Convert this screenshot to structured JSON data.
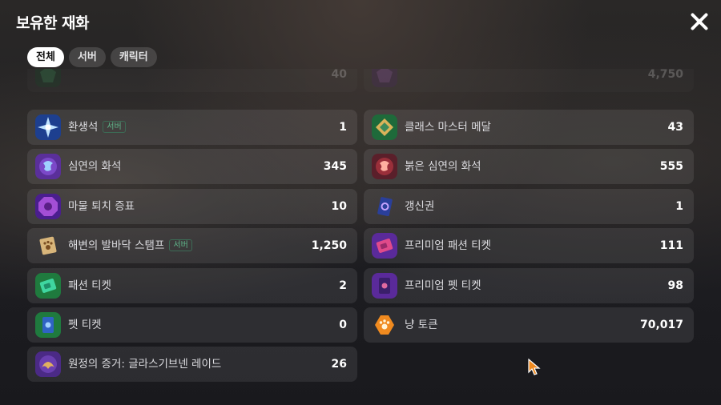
{
  "header": {
    "title": "보유한 재화"
  },
  "tabs": [
    {
      "label": "전체",
      "active": true
    },
    {
      "label": "서버",
      "active": false
    },
    {
      "label": "캐릭터",
      "active": false
    }
  ],
  "left_items": [
    {
      "name": "",
      "count": "40",
      "badge": "",
      "icon": "green-gem-icon",
      "faded": true
    },
    {
      "name": "환생석",
      "count": "1",
      "badge": "서버",
      "icon": "blue-star-icon"
    },
    {
      "name": "심연의 화석",
      "count": "345",
      "badge": "",
      "icon": "purple-dragon-fossil-icon"
    },
    {
      "name": "마물 퇴치 증표",
      "count": "10",
      "badge": "",
      "icon": "purple-octagon-emblem-icon"
    },
    {
      "name": "해변의 발바닥 스탬프",
      "count": "1,250",
      "badge": "서버",
      "icon": "paw-stamp-icon"
    },
    {
      "name": "패션 티켓",
      "count": "2",
      "badge": "",
      "icon": "green-fashion-ticket-icon"
    },
    {
      "name": "펫 티켓",
      "count": "0",
      "badge": "",
      "icon": "green-pet-ticket-icon"
    },
    {
      "name": "원정의 증거: 글라스기브넨 레이드",
      "count": "26",
      "badge": "",
      "icon": "raid-proof-icon"
    }
  ],
  "right_items": [
    {
      "name": "",
      "count": "4,750",
      "badge": "",
      "icon": "purple-coin-icon",
      "faded": true
    },
    {
      "name": "클래스 마스터 메달",
      "count": "43",
      "badge": "",
      "icon": "class-master-medal-icon"
    },
    {
      "name": "붉은 심연의 화석",
      "count": "555",
      "badge": "",
      "icon": "red-dragon-fossil-icon"
    },
    {
      "name": "갱신권",
      "count": "1",
      "badge": "",
      "icon": "renewal-card-icon"
    },
    {
      "name": "프리미엄 패션 티켓",
      "count": "111",
      "badge": "",
      "icon": "premium-fashion-ticket-icon"
    },
    {
      "name": "프리미엄 펫 티켓",
      "count": "98",
      "badge": "",
      "icon": "premium-pet-ticket-icon"
    },
    {
      "name": "냥 토큰",
      "count": "70,017",
      "badge": "",
      "icon": "cat-paw-token-icon"
    }
  ],
  "colors": {
    "accent_badge": "#5fb58a",
    "row_bg": "rgba(255,255,255,0.085)"
  }
}
